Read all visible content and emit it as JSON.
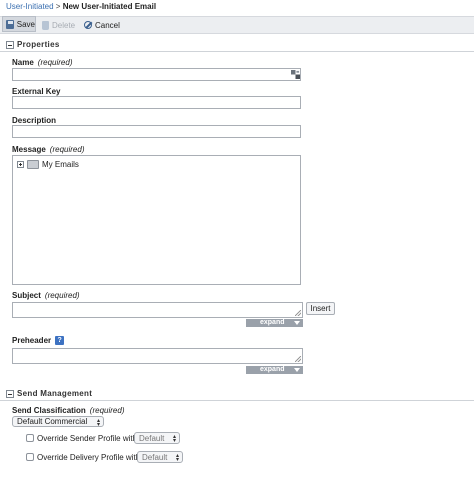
{
  "breadcrumb": {
    "parent": "User-Initiated",
    "separator": " > ",
    "current": "New User-Initiated Email"
  },
  "toolbar": {
    "save_label": "Save",
    "delete_label": "Delete",
    "cancel_label": "Cancel"
  },
  "sections": {
    "properties": "Properties",
    "send_management": "Send Management"
  },
  "fields": {
    "required_text": "(required)",
    "name_label": "Name",
    "external_key_label": "External Key",
    "description_label": "Description",
    "message_label": "Message",
    "subject_label": "Subject",
    "preheader_label": "Preheader",
    "send_classification_label": "Send Classification"
  },
  "values": {
    "name": "",
    "external_key": "",
    "description": "",
    "subject": "",
    "preheader": ""
  },
  "tree": {
    "root_label": "My Emails"
  },
  "buttons": {
    "insert_label": "Insert",
    "expand_label": "expand",
    "help_label": "?"
  },
  "send_management": {
    "classification_value": "Default Commercial",
    "override_sender_label": "Override Sender Profile with",
    "override_sender_value": "Default",
    "override_delivery_label": "Override Delivery Profile with",
    "override_delivery_value": "Default"
  },
  "colors": {
    "link": "#3a6fb0",
    "help_icon": "#3d72c2",
    "expand_bar": "#9aa1aa",
    "toolbar_bg": "#eceef1"
  },
  "icons": [
    "save-icon",
    "delete-icon",
    "cancel-icon",
    "collapse-icon",
    "tree-expand-icon",
    "folder-icon",
    "help-icon",
    "text-tools-icon"
  ]
}
